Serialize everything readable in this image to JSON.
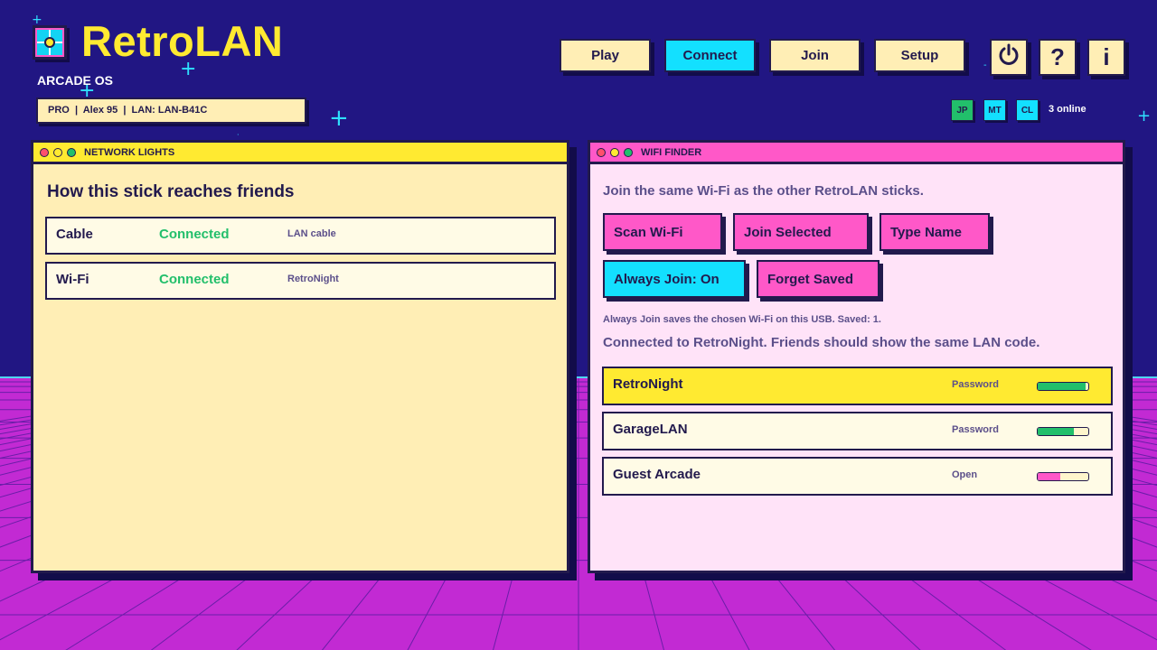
{
  "app": {
    "title": "RetroLAN",
    "subtitle": "ARCADE OS",
    "profile": "PRO  |  Alex 95  |  LAN: LAN-B41C",
    "logo_icon": "crosshair-icon"
  },
  "nav": {
    "buttons": [
      "Play",
      "Connect",
      "Join",
      "Setup"
    ],
    "active": "Connect",
    "icons": [
      {
        "name": "power-icon",
        "glyph": "⏻"
      },
      {
        "name": "help-icon",
        "glyph": "?"
      },
      {
        "name": "info-icon",
        "glyph": "i"
      }
    ]
  },
  "peers": {
    "items": [
      {
        "label": "JP",
        "color": "#22bf6b"
      },
      {
        "label": "MT",
        "color": "#13e0ff"
      },
      {
        "label": "CL",
        "color": "#13e0ff"
      }
    ],
    "online": "3 online"
  },
  "network_lights": {
    "title": "NETWORK LIGHTS",
    "heading": "How this stick reaches friends",
    "rows": [
      {
        "name": "Cable",
        "status": "Connected",
        "detail": "LAN cable"
      },
      {
        "name": "Wi-Fi",
        "status": "Connected",
        "detail": "RetroNight"
      }
    ]
  },
  "wifi_finder": {
    "title": "WIFI FINDER",
    "intro": "Join the same Wi-Fi as the other RetroLAN sticks.",
    "buttons": {
      "scan": "Scan Wi-Fi",
      "join_selected": "Join Selected",
      "type_name": "Type Name",
      "always_join": "Always Join: On",
      "forget": "Forget Saved"
    },
    "note": "Always Join saves the chosen Wi-Fi on this USB. Saved: 1.",
    "status": "Connected to RetroNight. Friends should show the same LAN code.",
    "networks": [
      {
        "ssid": "RetroNight",
        "security": "Password",
        "signal": 0.95,
        "signal_color": "#22bf6b",
        "selected": true
      },
      {
        "ssid": "GarageLAN",
        "security": "Password",
        "signal": 0.72,
        "signal_color": "#22bf6b",
        "selected": false
      },
      {
        "ssid": "Guest Arcade",
        "security": "Open",
        "signal": 0.45,
        "signal_color": "#ff58c8",
        "selected": false
      }
    ]
  },
  "colors": {
    "background": "#211683",
    "floor": "#c22ad3",
    "yellow": "#ffea31",
    "cyan": "#13e0ff",
    "pink": "#ff58c8",
    "green": "#22bf6b",
    "ink": "#221a4d"
  }
}
